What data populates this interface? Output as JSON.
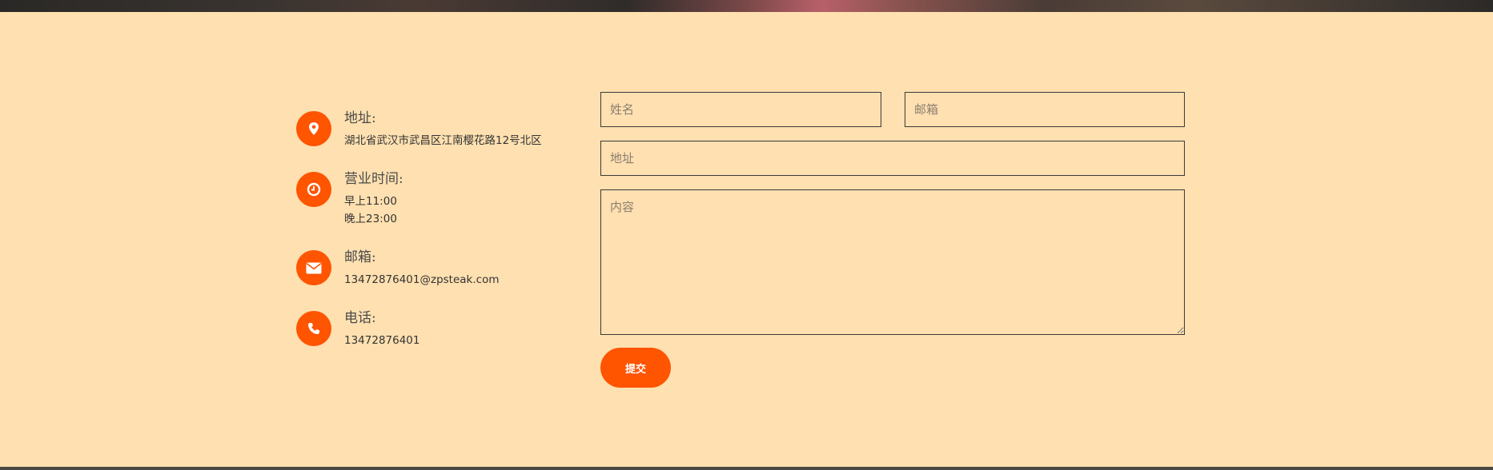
{
  "contact": {
    "address": {
      "title": "地址:",
      "lines": [
        "湖北省武汉市武昌区江南樱花路12号北区"
      ],
      "icon": "map-pin-icon"
    },
    "hours": {
      "title": "营业时间:",
      "lines": [
        "早上11:00",
        "晚上23:00"
      ],
      "icon": "clock-icon"
    },
    "email": {
      "title": "邮箱:",
      "lines": [
        "13472876401@zpsteak.com"
      ],
      "icon": "envelope-icon"
    },
    "phone": {
      "title": "电话:",
      "lines": [
        "13472876401"
      ],
      "icon": "phone-icon"
    }
  },
  "form": {
    "name_placeholder": "姓名",
    "email_placeholder": "邮箱",
    "address_placeholder": "地址",
    "content_placeholder": "内容",
    "submit_label": "提交"
  },
  "colors": {
    "background": "#ffe0b0",
    "accent": "#ff5400",
    "text": "#333333"
  }
}
